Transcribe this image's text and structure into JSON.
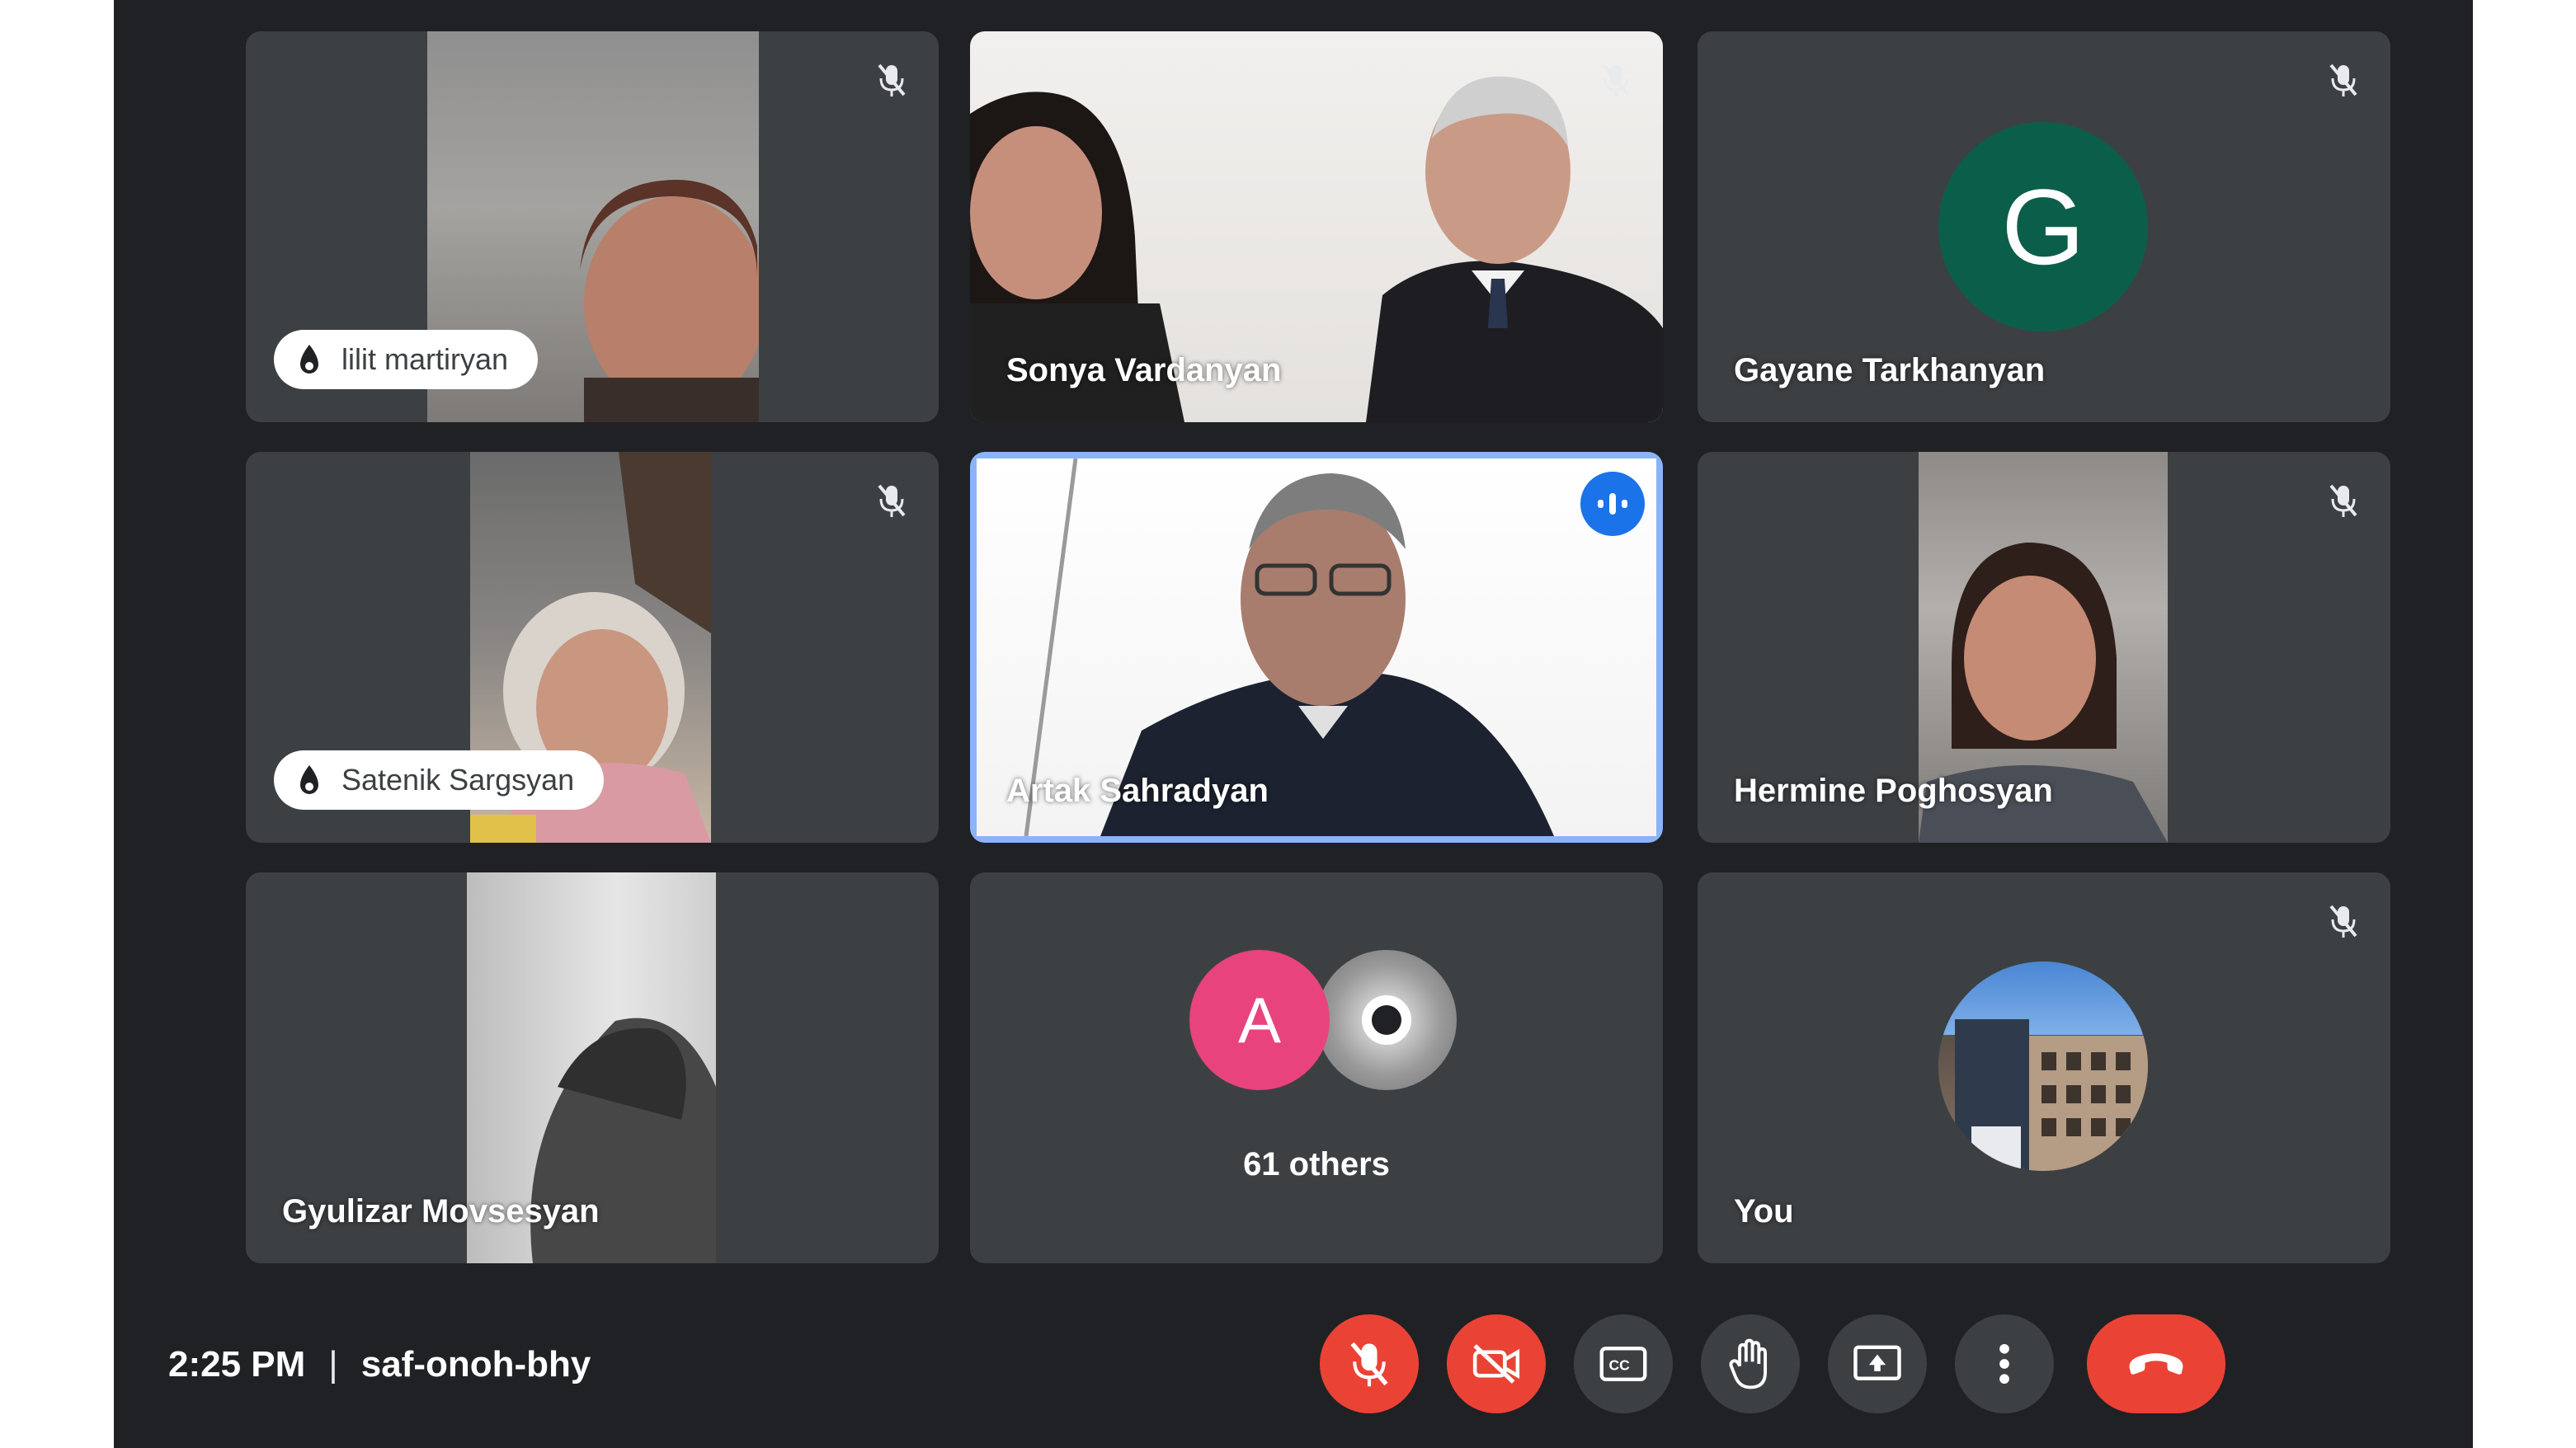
{
  "participants": {
    "lilit": {
      "name": "lilit martiryan"
    },
    "sonya": {
      "name": "Sonya Vardanyan"
    },
    "gayane": {
      "name": "Gayane Tarkhanyan",
      "initial": "G",
      "avatar_color": "#0b5f4a"
    },
    "satenik": {
      "name": "Satenik Sargsyan"
    },
    "artak": {
      "name": "Artak Sahradyan"
    },
    "hermine": {
      "name": "Hermine Poghosyan"
    },
    "gyulizar": {
      "name": "Gyulizar Movsesyan"
    },
    "others": {
      "label": "61 others",
      "initial": "A",
      "avatar_color": "#e8437d"
    },
    "you": {
      "name": "You"
    }
  },
  "bottom_bar": {
    "time": "2:25 PM",
    "separator": "|",
    "meeting_code": "saf-onoh-bhy"
  },
  "controls": [
    {
      "icon": "mic-off-icon"
    },
    {
      "icon": "camera-off-icon"
    },
    {
      "icon": "captions-icon"
    },
    {
      "icon": "raise-hand-icon"
    },
    {
      "icon": "present-screen-icon"
    },
    {
      "icon": "more-options-icon"
    },
    {
      "icon": "end-call-icon"
    }
  ],
  "colors": {
    "background": "#202124",
    "tile": "#3c4043",
    "danger": "#ea4335",
    "active_speaker": "#8ab4f8"
  }
}
